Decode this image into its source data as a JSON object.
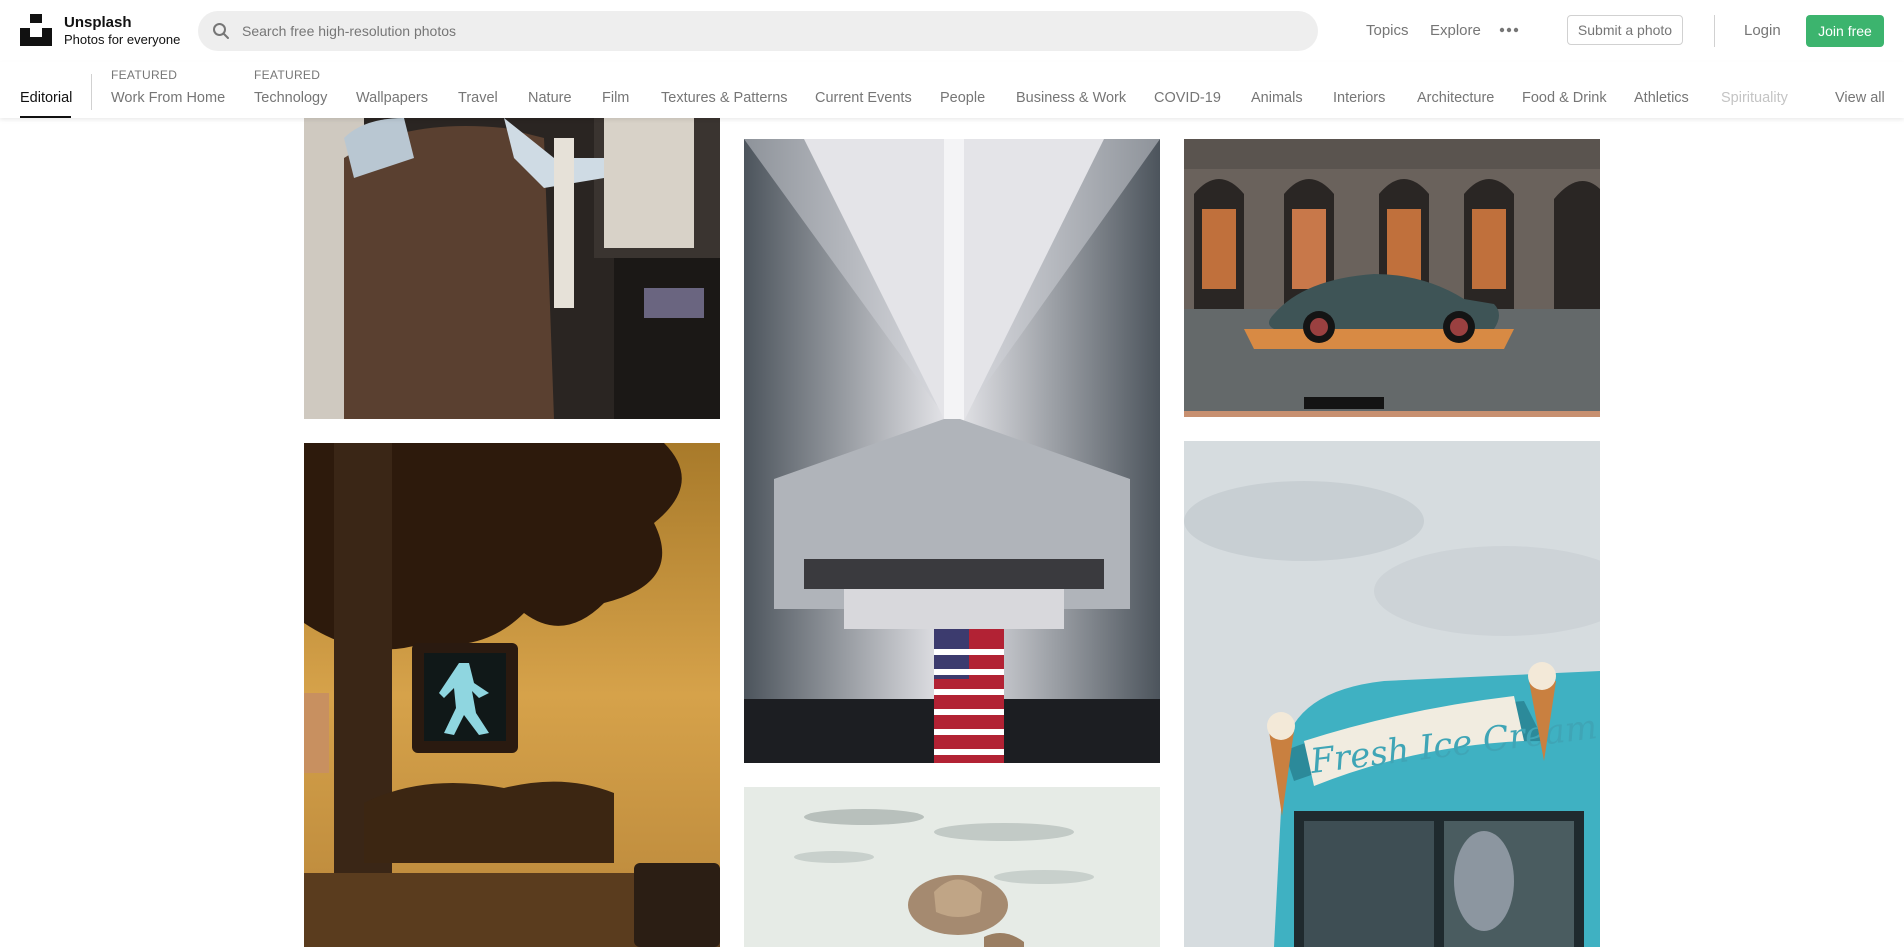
{
  "brand": {
    "name": "Unsplash",
    "tagline": "Photos for everyone"
  },
  "search": {
    "placeholder": "Search free high-resolution photos"
  },
  "header_links": {
    "topics": "Topics",
    "explore": "Explore"
  },
  "icons": {
    "search": "search-icon",
    "more": "more-horizontal-icon",
    "logo": "unsplash-logo"
  },
  "buttons": {
    "submit": "Submit a photo",
    "login": "Login",
    "join": "Join free"
  },
  "colors": {
    "join_button": "#3cb46e",
    "search_bg": "#eeeeee",
    "text_muted": "#767676"
  },
  "nav": {
    "editorial": "Editorial",
    "featured_1": {
      "tag": "FEATURED",
      "label": "Work From Home"
    },
    "featured_2": {
      "tag": "FEATURED",
      "label": "Technology"
    },
    "items": [
      "Wallpapers",
      "Travel",
      "Nature",
      "Film",
      "Textures & Patterns",
      "Current Events",
      "People",
      "Business & Work",
      "COVID-19",
      "Animals",
      "Interiors",
      "Architecture",
      "Food & Drink",
      "Athletics",
      "Spirituality"
    ],
    "view_all": "View all"
  },
  "photos": {
    "crosswalk_sign_text": "",
    "ice_cream_sign": "Fresh Ice Cream"
  }
}
